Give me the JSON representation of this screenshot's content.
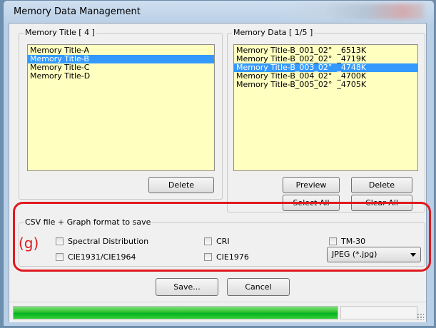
{
  "window": {
    "title": "Memory Data Management"
  },
  "memory_title_panel": {
    "label": "Memory Title [ 4 ]",
    "items": [
      {
        "label": "Memory Title-A",
        "selected": false
      },
      {
        "label": "Memory Title-B",
        "selected": true
      },
      {
        "label": "Memory Title-C",
        "selected": false
      },
      {
        "label": "Memory Title-D",
        "selected": false
      }
    ],
    "delete_label": "Delete"
  },
  "memory_data_panel": {
    "label": "Memory Data [ 1/5 ]",
    "items": [
      {
        "label": "Memory Title-B_001_02°  _6513K",
        "selected": false
      },
      {
        "label": "Memory Title-B_002_02°  _4719K",
        "selected": false
      },
      {
        "label": "Memory Title-B_003_02°  _4748K",
        "selected": true
      },
      {
        "label": "Memory Title-B_004_02°  _4700K",
        "selected": false
      },
      {
        "label": "Memory Title-B_005_02°  _4705K",
        "selected": false
      }
    ],
    "preview_label": "Preview",
    "delete_label": "Delete",
    "select_all_label": "Select All",
    "clear_all_label": "Clear All"
  },
  "csv_group": {
    "label": "CSV file + Graph format to save",
    "annotation": "(g)",
    "options": {
      "spectral": {
        "label": "Spectral Distribution",
        "checked": false
      },
      "cri": {
        "label": "CRI",
        "checked": false
      },
      "tm30": {
        "label": "TM-30",
        "checked": false
      },
      "cie1931": {
        "label": "CIE1931/CIE1964",
        "checked": false
      },
      "cie1976": {
        "label": "CIE1976",
        "checked": false
      }
    },
    "format_select": {
      "value": "JPEG (*.jpg)"
    }
  },
  "actions": {
    "save_label": "Save...",
    "cancel_label": "Cancel"
  },
  "status": {
    "progress": 1.0
  },
  "colors": {
    "list_background": "#ffffc0",
    "selection": "#3399ff",
    "highlight_annotation": "#e0191f",
    "progress_green": "#06b025"
  }
}
